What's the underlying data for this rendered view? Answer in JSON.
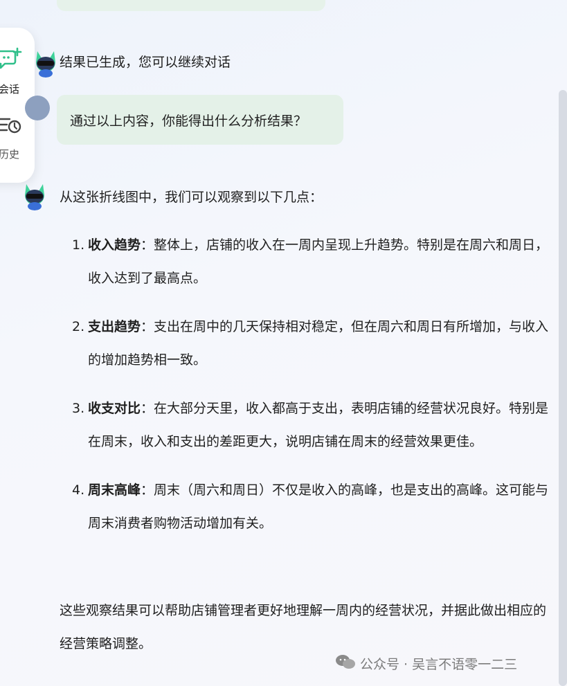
{
  "sidebar": {
    "new_chat_label": "会话",
    "history_label": "历史"
  },
  "status": {
    "generated_text": "结果已生成，您可以继续对话"
  },
  "user_message": {
    "text": "通过以上内容，你能得出什么分析结果？"
  },
  "answer": {
    "intro": "从这张折线图中，我们可以观察到以下几点：",
    "items": [
      {
        "num": "1.",
        "title": "收入趋势",
        "text": "：整体上，店铺的收入在一周内呈现上升趋势。特别是在周六和周日，收入达到了最高点。"
      },
      {
        "num": "2.",
        "title": "支出趋势",
        "text": "：支出在周中的几天保持相对稳定，但在周六和周日有所增加，与收入的增加趋势相一致。"
      },
      {
        "num": "3.",
        "title": "收支对比",
        "text": "：在大部分天里，收入都高于支出，表明店铺的经营状况良好。特别是在周末，收入和支出的差距更大，说明店铺在周末的经营效果更佳。"
      },
      {
        "num": "4.",
        "title": "周末高峰",
        "text": "：周末（周六和周日）不仅是收入的高峰，也是支出的高峰。这可能与周末消费者购物活动增加有关。"
      }
    ],
    "conclusion": "这些观察结果可以帮助店铺管理者更好地理解一周内的经营状况，并据此做出相应的经营策略调整。"
  },
  "watermark": {
    "text": "公众号 · 吴言不语零一二三"
  },
  "colors": {
    "user_bubble": "#e4f1e8",
    "accent_green": "#2fbf8a"
  }
}
